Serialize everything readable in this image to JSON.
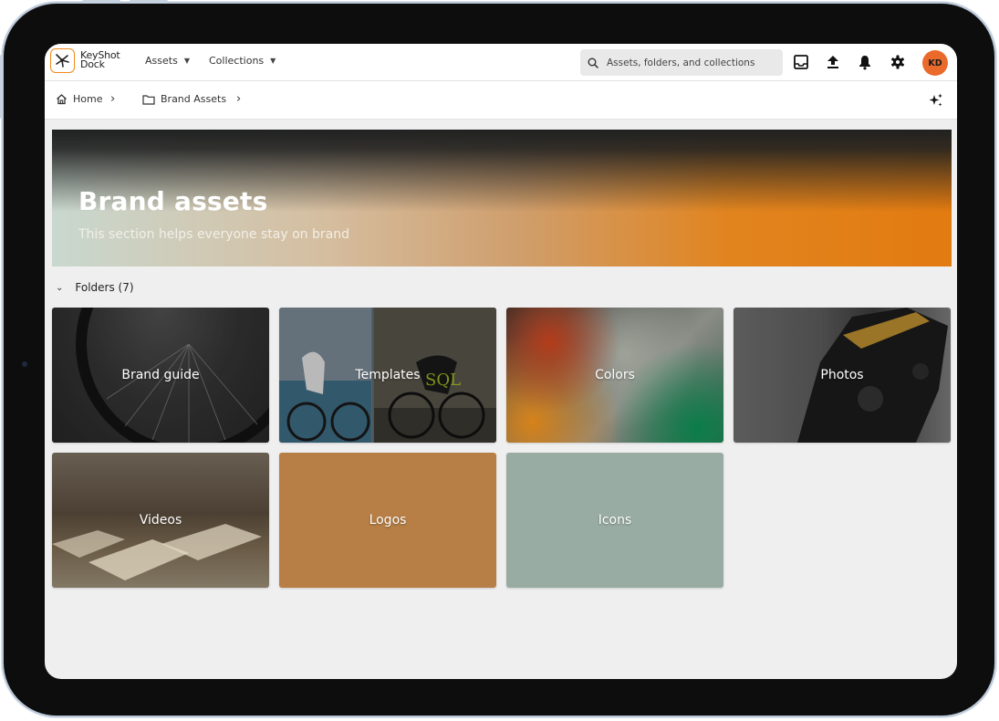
{
  "app": {
    "logo_line1": "KeyShot",
    "logo_line2": "Dock"
  },
  "topbar": {
    "menus": [
      {
        "label": "Assets"
      },
      {
        "label": "Collections"
      }
    ],
    "search_placeholder": "Assets, folders, and collections",
    "icons": [
      "inbox-icon",
      "upload-icon",
      "bell-icon",
      "gear-icon"
    ],
    "avatar_initials": "KD",
    "avatar_color": "#ea6a2c",
    "accent_color": "#f08a1c"
  },
  "breadcrumb": {
    "items": [
      {
        "label": "Home",
        "icon": "home-icon"
      },
      {
        "label": "Brand Assets",
        "icon": "folder-icon"
      }
    ]
  },
  "hero": {
    "title": "Brand assets",
    "subtitle": "This section helps everyone stay on brand"
  },
  "folders": {
    "heading": "Folders (7)",
    "items": [
      {
        "label": "Brand guide"
      },
      {
        "label": "Templates"
      },
      {
        "label": "Colors"
      },
      {
        "label": "Photos"
      },
      {
        "label": "Videos"
      },
      {
        "label": "Logos",
        "color": "#b77f45"
      },
      {
        "label": "Icons",
        "color": "#99aca4"
      }
    ]
  }
}
